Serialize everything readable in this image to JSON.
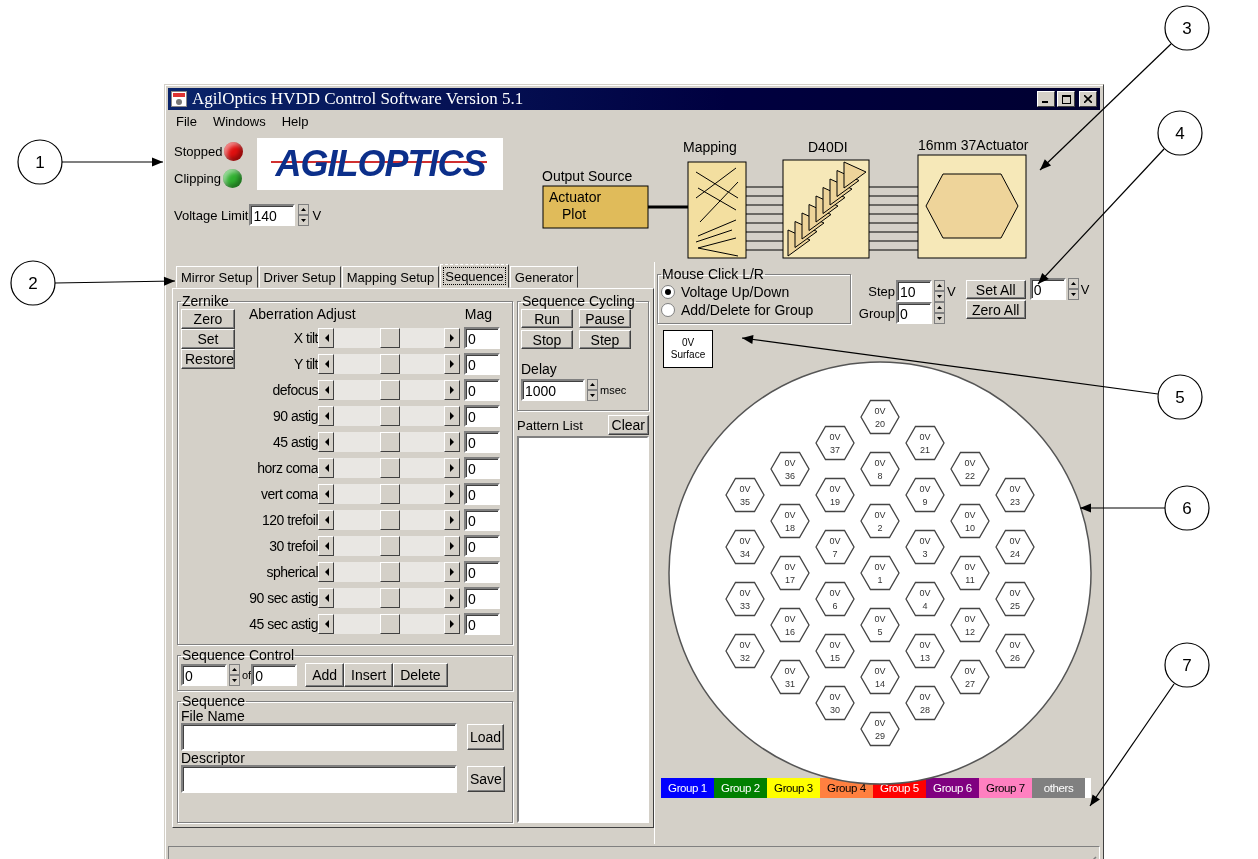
{
  "window": {
    "title": "AgilOptics HVDD Control Software Version 5.1"
  },
  "menu": [
    "File",
    "Windows",
    "Help"
  ],
  "status_lights": [
    {
      "label": "Stopped",
      "color": "#e01010"
    },
    {
      "label": "Clipping",
      "color": "#30b030"
    }
  ],
  "logo": {
    "text": "AGILOPTICS"
  },
  "voltage_limit": {
    "label": "Voltage Limit",
    "value": "140",
    "unit": "V"
  },
  "diagram": {
    "output_source": {
      "label": "Output Source",
      "lines": [
        "Actuator",
        "Plot"
      ]
    },
    "stages": [
      {
        "label": "Mapping",
        "kind": "mapping"
      },
      {
        "label": "D40DI",
        "kind": "driver"
      },
      {
        "label": "16mm 37Actuator",
        "kind": "mirror"
      }
    ]
  },
  "tabs": [
    {
      "label": "Mirror Setup",
      "selected": false
    },
    {
      "label": "Driver Setup",
      "selected": false
    },
    {
      "label": "Mapping Setup",
      "selected": false
    },
    {
      "label": "Sequence",
      "selected": true
    },
    {
      "label": "Generator",
      "selected": false
    }
  ],
  "zernike": {
    "title": "Zernike",
    "buttons": [
      "Zero",
      "Set",
      "Restore"
    ],
    "header": "Aberration Adjust",
    "mag_header": "Mag",
    "rows": [
      {
        "label": "X tilt",
        "level": 0.5,
        "value": "0"
      },
      {
        "label": "Y tilt",
        "level": 0.5,
        "value": "0"
      },
      {
        "label": "defocus",
        "level": 0.5,
        "value": "0"
      },
      {
        "label": "90 astig",
        "level": 0.5,
        "value": "0"
      },
      {
        "label": "45 astig",
        "level": 0.5,
        "value": "0"
      },
      {
        "label": "horz coma",
        "level": 0.5,
        "value": "0"
      },
      {
        "label": "vert coma",
        "level": 0.5,
        "value": "0"
      },
      {
        "label": "120 trefoil",
        "level": 0.5,
        "value": "0"
      },
      {
        "label": "30 trefoil",
        "level": 0.5,
        "value": "0"
      },
      {
        "label": "spherical",
        "level": 0.5,
        "value": "0"
      },
      {
        "label": "90 sec astig",
        "level": 0.5,
        "value": "0"
      },
      {
        "label": "45 sec astig",
        "level": 0.5,
        "value": "0"
      }
    ]
  },
  "sequence_cycling": {
    "title": "Sequence Cycling",
    "buttons": [
      "Run",
      "Pause",
      "Stop",
      "Step"
    ],
    "delay_label": "Delay",
    "delay": "1000",
    "unit": "msec"
  },
  "pattern_list": {
    "label": "Pattern List",
    "clear": "Clear"
  },
  "sequence_control": {
    "title": "Sequence Control",
    "current": "0",
    "of": "of",
    "total": "0",
    "buttons": [
      "Add",
      "Insert",
      "Delete"
    ]
  },
  "sequence": {
    "title": "Sequence",
    "file_label": "File Name",
    "load": "Load",
    "descriptor_label": "Descriptor",
    "save": "Save"
  },
  "mouse_click": {
    "title": "Mouse Click L/R",
    "options": [
      {
        "label": "Voltage Up/Down",
        "selected": true
      },
      {
        "label": "Add/Delete for Group",
        "selected": false
      }
    ]
  },
  "step": {
    "label": "Step",
    "value": "10",
    "unit": "V"
  },
  "group": {
    "label": "Group",
    "value": "0"
  },
  "set_all": "Set All",
  "zero_all": "Zero All",
  "all_value": {
    "value": "0",
    "unit": "V"
  },
  "surface": {
    "voltage": "0V",
    "label": "Surface"
  },
  "actuator_columns": [
    [
      {
        "voltage": "0V",
        "number": "35"
      },
      {
        "voltage": "0V",
        "number": "34"
      },
      {
        "voltage": "0V",
        "number": "33"
      },
      {
        "voltage": "0V",
        "number": "32"
      }
    ],
    [
      {
        "voltage": "0V",
        "number": "36"
      },
      {
        "voltage": "0V",
        "number": "18"
      },
      {
        "voltage": "0V",
        "number": "17"
      },
      {
        "voltage": "0V",
        "number": "16"
      },
      {
        "voltage": "0V",
        "number": "31"
      }
    ],
    [
      {
        "voltage": "0V",
        "number": "37"
      },
      {
        "voltage": "0V",
        "number": "19"
      },
      {
        "voltage": "0V",
        "number": "7"
      },
      {
        "voltage": "0V",
        "number": "6"
      },
      {
        "voltage": "0V",
        "number": "15"
      },
      {
        "voltage": "0V",
        "number": "30"
      }
    ],
    [
      {
        "voltage": "0V",
        "number": "20"
      },
      {
        "voltage": "0V",
        "number": "8"
      },
      {
        "voltage": "0V",
        "number": "2"
      },
      {
        "voltage": "0V",
        "number": "1"
      },
      {
        "voltage": "0V",
        "number": "5"
      },
      {
        "voltage": "0V",
        "number": "14"
      },
      {
        "voltage": "0V",
        "number": "29"
      }
    ],
    [
      {
        "voltage": "0V",
        "number": "21"
      },
      {
        "voltage": "0V",
        "number": "9"
      },
      {
        "voltage": "0V",
        "number": "3"
      },
      {
        "voltage": "0V",
        "number": "4"
      },
      {
        "voltage": "0V",
        "number": "13"
      },
      {
        "voltage": "0V",
        "number": "28"
      }
    ],
    [
      {
        "voltage": "0V",
        "number": "22"
      },
      {
        "voltage": "0V",
        "number": "10"
      },
      {
        "voltage": "0V",
        "number": "11"
      },
      {
        "voltage": "0V",
        "number": "12"
      },
      {
        "voltage": "0V",
        "number": "27"
      }
    ],
    [
      {
        "voltage": "0V",
        "number": "23"
      },
      {
        "voltage": "0V",
        "number": "24"
      },
      {
        "voltage": "0V",
        "number": "25"
      },
      {
        "voltage": "0V",
        "number": "26"
      }
    ]
  ],
  "groups": [
    {
      "label": "Group 1",
      "color": "#0000ff"
    },
    {
      "label": "Group 2",
      "color": "#008000"
    },
    {
      "label": "Group 3",
      "color": "#ffff00"
    },
    {
      "label": "Group 4",
      "color": "#ff8040"
    },
    {
      "label": "Group 5",
      "color": "#ff0000"
    },
    {
      "label": "Group 6",
      "color": "#800080"
    },
    {
      "label": "Group 7",
      "color": "#ff80c0"
    },
    {
      "label": "others",
      "color": "#808080"
    }
  ],
  "callouts": [
    "1",
    "2",
    "3",
    "4",
    "5",
    "6",
    "7"
  ]
}
